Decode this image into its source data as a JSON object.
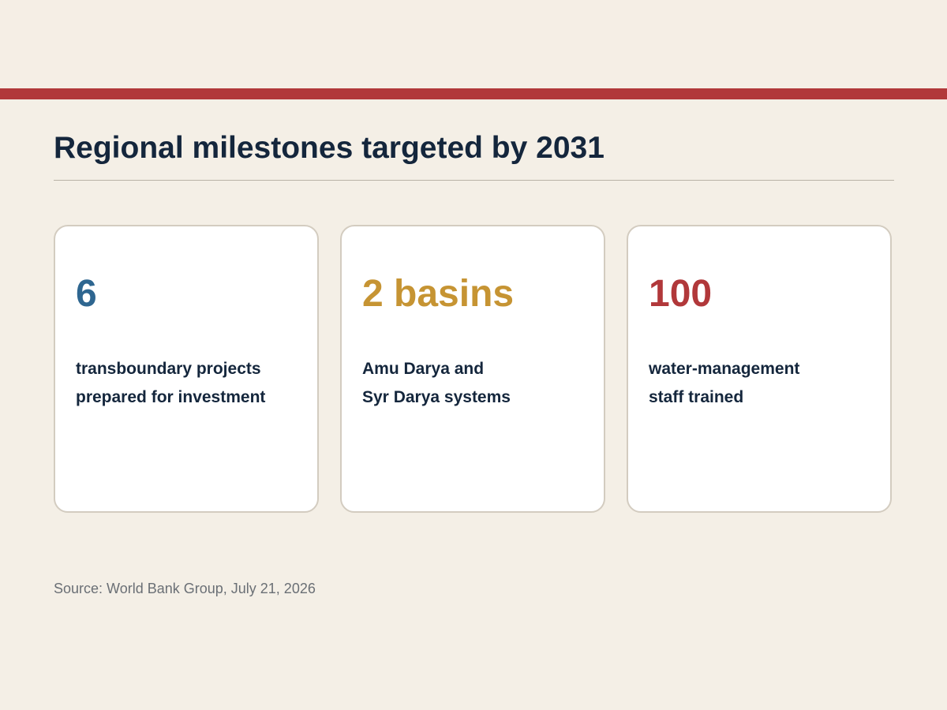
{
  "title": "Regional milestones targeted by 2031",
  "cards": [
    {
      "value": "6",
      "value_color": "#2e6690",
      "description_lines": [
        "transboundary projects",
        "prepared for investment"
      ]
    },
    {
      "value": "2 basins",
      "value_color": "#c69433",
      "description_lines": [
        "Amu Darya and",
        "Syr Darya systems"
      ]
    },
    {
      "value": "100",
      "value_color": "#b1383a",
      "description_lines": [
        "water-management",
        "staff trained"
      ]
    }
  ],
  "source": "Source: World Bank Group, July 21, 2026",
  "colors": {
    "accent_bar": "#b1383a",
    "title_text": "#14263c",
    "background": "#f4efe6"
  }
}
